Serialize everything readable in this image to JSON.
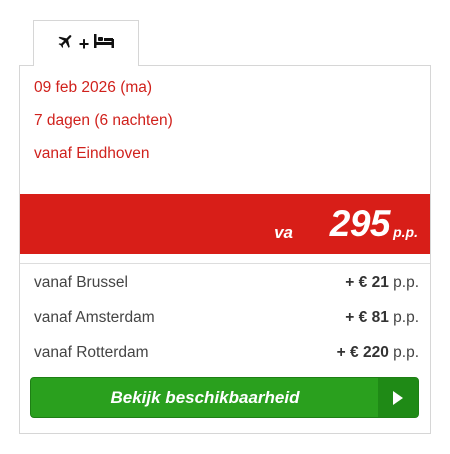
{
  "tab": {
    "icons": [
      "airplane-icon",
      "plus-icon",
      "bed-icon"
    ],
    "plus": "+"
  },
  "info": {
    "date": "09 feb 2026 (ma)",
    "duration": "7 dagen (6 nachten)",
    "departure": "vanaf Eindhoven"
  },
  "price": {
    "prefix": "va",
    "amount": "295",
    "suffix": "p.p."
  },
  "alternatives": [
    {
      "label": "vanaf Brussel",
      "surcharge": "+ € 21",
      "unit": "p.p."
    },
    {
      "label": "vanaf Amsterdam",
      "surcharge": "+ € 81",
      "unit": "p.p."
    },
    {
      "label": "vanaf Rotterdam",
      "surcharge": "+ € 220",
      "unit": "p.p."
    }
  ],
  "button": {
    "label": "Bekijk beschikbaarheid",
    "icon": "play-arrow-icon"
  },
  "colors": {
    "accent_red": "#d81e18",
    "text_red": "#d0211c",
    "button_green": "#2aa01e"
  }
}
